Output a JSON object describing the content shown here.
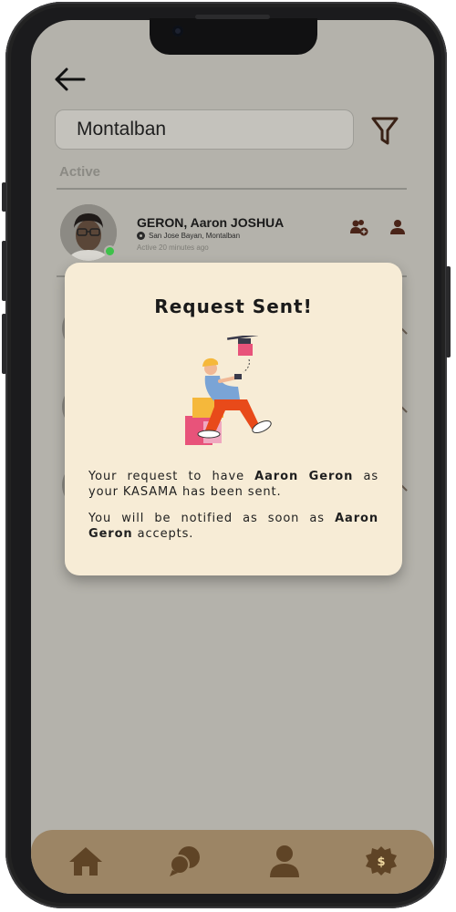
{
  "search": {
    "value": "Montalban"
  },
  "section": {
    "label": "Active"
  },
  "user": {
    "name": "GERON, Aaron JOSHUA",
    "location": "San Jose Bayan, Montalban",
    "status": "Active 20 minutes ago"
  },
  "modal": {
    "title": "Request Sent!",
    "line1_pre": "Your request to have ",
    "line1_name": "Aaron Geron",
    "line1_post": " as your KASAMA has been sent.",
    "line2_pre": "You will be notified as soon as ",
    "line2_name": "Aaron Geron",
    "line2_post": " accepts."
  },
  "icons": {
    "back": "arrow-left-icon",
    "filter": "funnel-icon",
    "add_friend": "add-user-icon",
    "profile": "user-icon",
    "nav": [
      "home-icon",
      "chat-icon",
      "profile-icon",
      "settings-icon"
    ]
  },
  "colors": {
    "overlay_bg": "#b4b2ab",
    "modal_bg": "#f7ecd6",
    "navbar_bg": "#9c8565",
    "nav_icon": "#5f4426",
    "accent_dark": "#3a2216",
    "online": "#3ec14a"
  }
}
